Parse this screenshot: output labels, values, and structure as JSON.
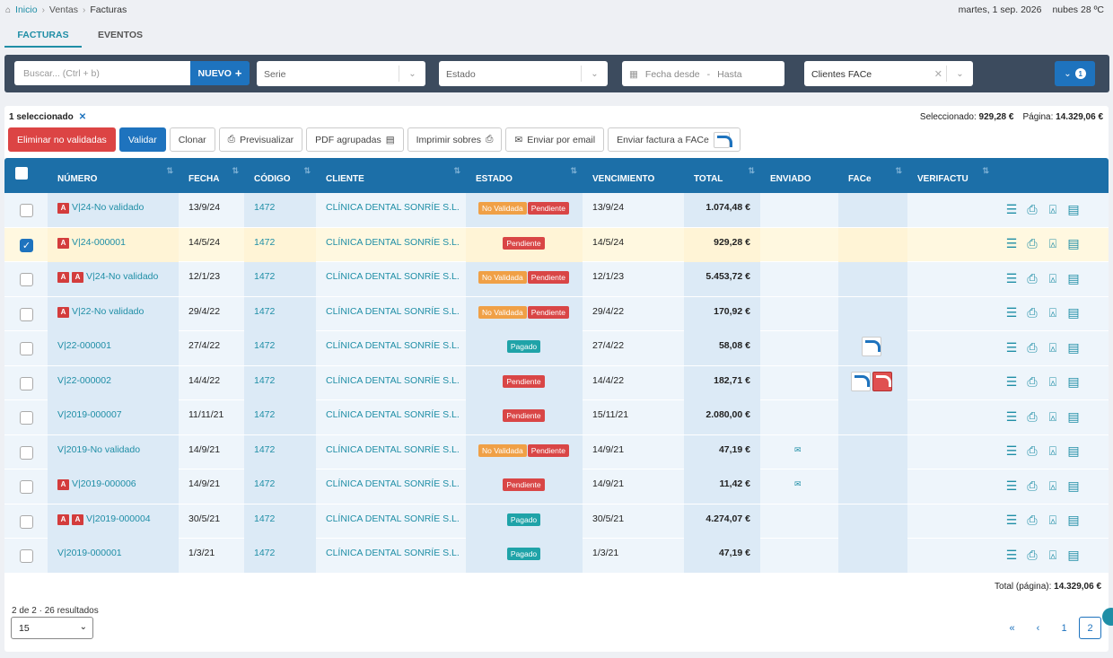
{
  "breadcrumb": [
    "Inicio",
    "Ventas",
    "Facturas"
  ],
  "top_right": {
    "date": "martes, 1 sep. 2026",
    "weather": "nubes 28 ºC"
  },
  "tabs": [
    {
      "label": "FACTURAS",
      "active": true
    },
    {
      "label": "EVENTOS",
      "active": false
    }
  ],
  "filters": {
    "search_placeholder": "Buscar... (Ctrl + b)",
    "new_label": "NUEVO",
    "serie_placeholder": "Serie",
    "estado_placeholder": "Estado",
    "fecha_desde": "Fecha desde",
    "date_sep": "-",
    "hasta": "Hasta",
    "clientes": "Clientes FACe",
    "filter_count": "1"
  },
  "selection": {
    "text": "1 seleccionado",
    "seleccionado_label": "Seleccionado:",
    "seleccionado_value": "929,28 €",
    "pagina_label": "Página:",
    "pagina_value": "14.329,06 €"
  },
  "actions": {
    "eliminar": "Eliminar no validadas",
    "validar": "Validar",
    "clonar": "Clonar",
    "previsualizar": "Previsualizar",
    "pdf": "PDF agrupadas",
    "imprimir": "Imprimir sobres",
    "email": "Enviar por email",
    "face": "Enviar factura a FACe"
  },
  "columns": [
    "NÚMERO",
    "FECHA",
    "CÓDIGO",
    "CLIENTE",
    "ESTADO",
    "VENCIMIENTO",
    "TOTAL",
    "ENVIADO",
    "FACe",
    "VERIFACTU"
  ],
  "status_labels": {
    "nv": "No Validada",
    "pe": "Pendiente",
    "pa": "Pagado"
  },
  "rows": [
    {
      "checked": false,
      "badges": 1,
      "numero": "V|24-No validado",
      "fecha": "13/9/24",
      "codigo": "1472",
      "cliente": "CLÍNICA DENTAL SONRÍE S.L.",
      "estado": [
        "nv",
        "pe"
      ],
      "vencimiento": "13/9/24",
      "total": "1.074,48 €",
      "enviado": false,
      "face": 0
    },
    {
      "checked": true,
      "badges": 1,
      "numero": "V|24-000001",
      "fecha": "14/5/24",
      "codigo": "1472",
      "cliente": "CLÍNICA DENTAL SONRÍE S.L.",
      "estado": [
        "pe"
      ],
      "vencimiento": "14/5/24",
      "total": "929,28 €",
      "enviado": false,
      "face": 0
    },
    {
      "checked": false,
      "badges": 2,
      "numero": "V|24-No validado",
      "fecha": "12/1/23",
      "codigo": "1472",
      "cliente": "CLÍNICA DENTAL SONRÍE S.L.",
      "estado": [
        "nv",
        "pe"
      ],
      "vencimiento": "12/1/23",
      "total": "5.453,72 €",
      "enviado": false,
      "face": 0
    },
    {
      "checked": false,
      "badges": 1,
      "numero": "V|22-No validado",
      "fecha": "29/4/22",
      "codigo": "1472",
      "cliente": "CLÍNICA DENTAL SONRÍE S.L.",
      "estado": [
        "nv",
        "pe"
      ],
      "vencimiento": "29/4/22",
      "total": "170,92 €",
      "enviado": false,
      "face": 0
    },
    {
      "checked": false,
      "badges": 0,
      "numero": "V|22-000001",
      "fecha": "27/4/22",
      "codigo": "1472",
      "cliente": "CLÍNICA DENTAL SONRÍE S.L.",
      "estado": [
        "pa"
      ],
      "vencimiento": "27/4/22",
      "total": "58,08 €",
      "enviado": false,
      "face": 1
    },
    {
      "checked": false,
      "badges": 0,
      "numero": "V|22-000002",
      "fecha": "14/4/22",
      "codigo": "1472",
      "cliente": "CLÍNICA DENTAL SONRÍE S.L.",
      "estado": [
        "pe"
      ],
      "vencimiento": "14/4/22",
      "total": "182,71 €",
      "enviado": false,
      "face": 2
    },
    {
      "checked": false,
      "badges": 0,
      "numero": "V|2019-000007",
      "fecha": "11/11/21",
      "codigo": "1472",
      "cliente": "CLÍNICA DENTAL SONRÍE S.L.",
      "estado": [
        "pe"
      ],
      "vencimiento": "15/11/21",
      "total": "2.080,00 €",
      "enviado": false,
      "face": 0
    },
    {
      "checked": false,
      "badges": 0,
      "numero": "V|2019-No validado",
      "fecha": "14/9/21",
      "codigo": "1472",
      "cliente": "CLÍNICA DENTAL SONRÍE S.L.",
      "estado": [
        "nv",
        "pe"
      ],
      "vencimiento": "14/9/21",
      "total": "47,19 €",
      "enviado": true,
      "face": 0
    },
    {
      "checked": false,
      "badges": 1,
      "numero": "V|2019-000006",
      "fecha": "14/9/21",
      "codigo": "1472",
      "cliente": "CLÍNICA DENTAL SONRÍE S.L.",
      "estado": [
        "pe"
      ],
      "vencimiento": "14/9/21",
      "total": "11,42 €",
      "enviado": true,
      "face": 0
    },
    {
      "checked": false,
      "badges": 2,
      "numero": "V|2019-000004",
      "fecha": "30/5/21",
      "codigo": "1472",
      "cliente": "CLÍNICA DENTAL SONRÍE S.L.",
      "estado": [
        "pa"
      ],
      "vencimiento": "30/5/21",
      "total": "4.274,07 €",
      "enviado": false,
      "face": 0
    },
    {
      "checked": false,
      "badges": 0,
      "numero": "V|2019-000001",
      "fecha": "1/3/21",
      "codigo": "1472",
      "cliente": "CLÍNICA DENTAL SONRÍE S.L.",
      "estado": [
        "pa"
      ],
      "vencimiento": "1/3/21",
      "total": "47,19 €",
      "enviado": false,
      "face": 0
    }
  ],
  "footer": {
    "total_label": "Total (página):",
    "total_value": "14.329,06 €",
    "pag_info": "2 de 2 · 26 resultados",
    "page_size": "15",
    "pages": [
      "«",
      "‹",
      "1",
      "2"
    ],
    "active_page": "2"
  },
  "colors": {
    "accent": "#1e73be",
    "header": "#1c6fa8",
    "link": "#1f8ea6"
  }
}
